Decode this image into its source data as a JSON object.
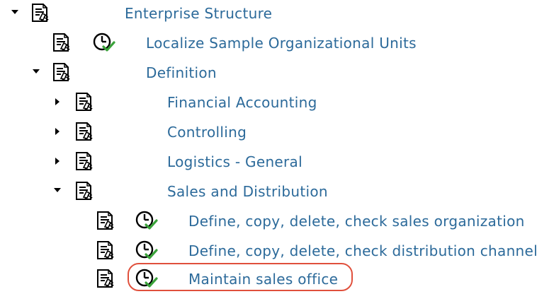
{
  "tree": {
    "nodes": [
      {
        "label": "Enterprise Structure",
        "expander": "expanded",
        "icons": [
          "document-icon"
        ]
      },
      {
        "label": "Localize Sample Organizational Units",
        "expander": "none",
        "icons": [
          "document-icon",
          "execute-clock-icon"
        ]
      },
      {
        "label": "Definition",
        "expander": "expanded",
        "icons": [
          "document-icon"
        ]
      },
      {
        "label": "Financial Accounting",
        "expander": "collapsed",
        "icons": [
          "document-icon"
        ]
      },
      {
        "label": "Controlling",
        "expander": "collapsed",
        "icons": [
          "document-icon"
        ]
      },
      {
        "label": "Logistics - General",
        "expander": "collapsed",
        "icons": [
          "document-icon"
        ]
      },
      {
        "label": "Sales and Distribution",
        "expander": "expanded",
        "icons": [
          "document-icon"
        ]
      },
      {
        "label": "Define, copy, delete, check sales organization",
        "expander": "none",
        "icons": [
          "document-icon",
          "execute-clock-icon"
        ]
      },
      {
        "label": "Define, copy, delete, check distribution channel",
        "expander": "none",
        "icons": [
          "document-icon",
          "execute-clock-icon"
        ]
      },
      {
        "label": "Maintain sales office",
        "expander": "none",
        "icons": [
          "document-icon",
          "execute-clock-icon"
        ],
        "highlighted": true
      }
    ]
  },
  "colors": {
    "label": "#2c6a9a",
    "highlight": "#e0503c",
    "check": "#3aa23a"
  }
}
